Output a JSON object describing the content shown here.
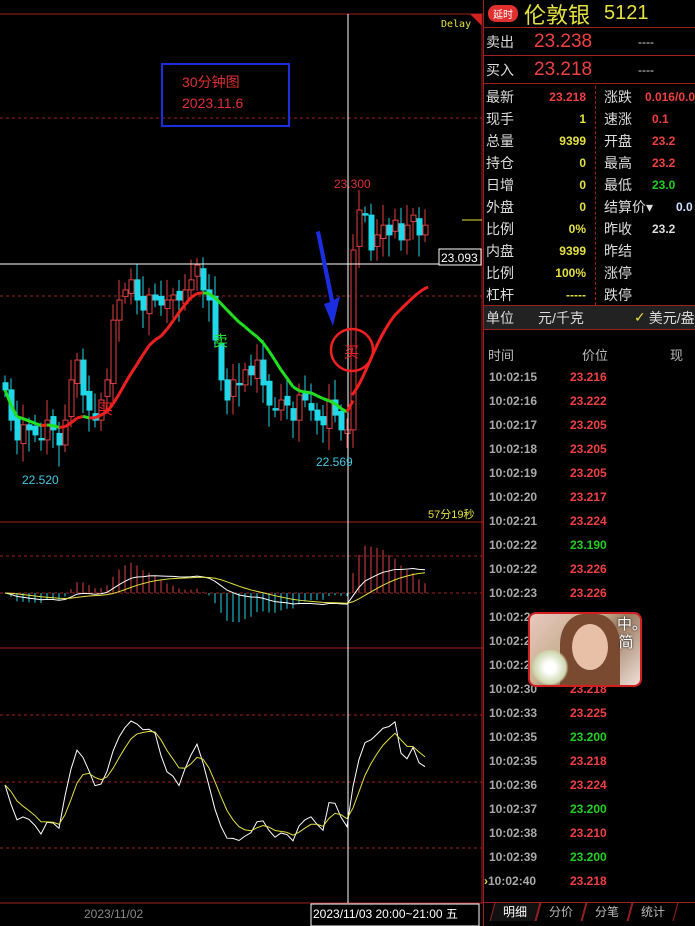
{
  "header": {
    "badge": "延时",
    "name": "伦敦银",
    "code": "5121"
  },
  "quotes": [
    {
      "label": "卖出",
      "price": "23.238",
      "vol": "----"
    },
    {
      "label": "买入",
      "price": "23.218",
      "vol": "----"
    }
  ],
  "stats_left": [
    {
      "label": "最新",
      "value": "23.218",
      "color": "red"
    },
    {
      "label": "现手",
      "value": "1",
      "color": "yel"
    },
    {
      "label": "总量",
      "value": "9399",
      "color": "yel"
    },
    {
      "label": "持仓",
      "value": "0",
      "color": "yel"
    },
    {
      "label": "日增",
      "value": "0",
      "color": "yel"
    },
    {
      "label": "外盘",
      "value": "0",
      "color": "yel"
    },
    {
      "label": "比例",
      "value": "0%",
      "color": "yel"
    },
    {
      "label": "内盘",
      "value": "9399",
      "color": "yel"
    },
    {
      "label": "比例",
      "value": "100%",
      "color": "yel"
    },
    {
      "label": "杠杆",
      "value": "-----",
      "color": "yel"
    }
  ],
  "stats_right": [
    {
      "label": "涨跌",
      "value": "0.016/0.0",
      "color": "red"
    },
    {
      "label": "速涨",
      "value": "0.1",
      "color": "red"
    },
    {
      "label": "开盘",
      "value": "23.2",
      "color": "red"
    },
    {
      "label": "最高",
      "value": "23.2",
      "color": "red"
    },
    {
      "label": "最低",
      "value": "23.0",
      "color": "grn"
    },
    {
      "label": "结算价▾",
      "value": "0.0",
      "color": "blu"
    },
    {
      "label": "昨收",
      "value": "23.2",
      "color": "wht"
    },
    {
      "label": "昨结",
      "value": "",
      "color": "wht"
    },
    {
      "label": "涨停",
      "value": "",
      "color": "wht"
    },
    {
      "label": "跌停",
      "value": "",
      "color": "wht"
    }
  ],
  "unit": {
    "label": "单位",
    "value": "元/千克",
    "option": "美元/盎"
  },
  "ticks_header": {
    "time": "时间",
    "price": "价位",
    "vol": "现"
  },
  "ticks": [
    {
      "time": "10:02:15",
      "price": "23.216",
      "color": "red"
    },
    {
      "time": "10:02:16",
      "price": "23.222",
      "color": "red"
    },
    {
      "time": "10:02:17",
      "price": "23.205",
      "color": "red"
    },
    {
      "time": "10:02:18",
      "price": "23.205",
      "color": "red"
    },
    {
      "time": "10:02:19",
      "price": "23.205",
      "color": "red"
    },
    {
      "time": "10:02:20",
      "price": "23.217",
      "color": "red"
    },
    {
      "time": "10:02:21",
      "price": "23.224",
      "color": "red"
    },
    {
      "time": "10:02:22",
      "price": "23.190",
      "color": "grn"
    },
    {
      "time": "10:02:22",
      "price": "23.226",
      "color": "red"
    },
    {
      "time": "10:02:23",
      "price": "23.226",
      "color": "red"
    },
    {
      "time": "10:02:2",
      "price": "",
      "color": "red"
    },
    {
      "time": "10:02:2",
      "price": "",
      "color": "red"
    },
    {
      "time": "10:02:2",
      "price": "",
      "color": "red"
    },
    {
      "time": "10:02:30",
      "price": "23.218",
      "color": "red"
    },
    {
      "time": "10:02:33",
      "price": "23.225",
      "color": "red"
    },
    {
      "time": "10:02:35",
      "price": "23.200",
      "color": "grn"
    },
    {
      "time": "10:02:35",
      "price": "23.218",
      "color": "red"
    },
    {
      "time": "10:02:36",
      "price": "23.224",
      "color": "red"
    },
    {
      "time": "10:02:37",
      "price": "23.200",
      "color": "grn"
    },
    {
      "time": "10:02:38",
      "price": "23.210",
      "color": "red"
    },
    {
      "time": "10:02:39",
      "price": "23.200",
      "color": "grn"
    },
    {
      "time": "10:02:40",
      "price": "23.218",
      "color": "red"
    }
  ],
  "popup": {
    "text": "中。简"
  },
  "tabs": [
    "明细",
    "分价",
    "分笔",
    "统计"
  ],
  "chart": {
    "delay": "Delay",
    "annotation_title": "30分钟图",
    "annotation_date": "2023.11.6",
    "high_label": "23.300",
    "low_label_1": "22.520",
    "low_label_2": "22.569",
    "cursor_price": "23.093",
    "countdown": "57分19秒",
    "buy_mark": "买",
    "sell_mark": "卖",
    "date_1": "2023/11/02",
    "date_cursor": "2023/11/03 20:00~21:00 五"
  },
  "chart_data": {
    "type": "candlestick",
    "title": "30分钟图 2023.11.6",
    "ylim": [
      22.45,
      23.35
    ],
    "closes": [
      22.743,
      22.659,
      22.604,
      22.646,
      22.632,
      22.618,
      22.604,
      22.659,
      22.632,
      22.59,
      22.659,
      22.771,
      22.826,
      22.729,
      22.687,
      22.659,
      22.715,
      22.771,
      22.937,
      22.993,
      23.021,
      23.049,
      22.993,
      22.965,
      23.007,
      22.993,
      22.979,
      22.993,
      23.007,
      22.993,
      23.021,
      23.049,
      23.09,
      23.021,
      22.993,
      22.882,
      22.771,
      22.715,
      22.771,
      22.757,
      22.799,
      22.785,
      22.826,
      22.757,
      22.701,
      22.687,
      22.715,
      22.701,
      22.659,
      22.729,
      22.715,
      22.687,
      22.659,
      22.646,
      22.715,
      22.673,
      22.632,
      22.632,
      23.132,
      23.243,
      23.229,
      23.132,
      23.174,
      23.201,
      23.174,
      23.215,
      23.16,
      23.201,
      23.229,
      23.174,
      23.201
    ]
  }
}
